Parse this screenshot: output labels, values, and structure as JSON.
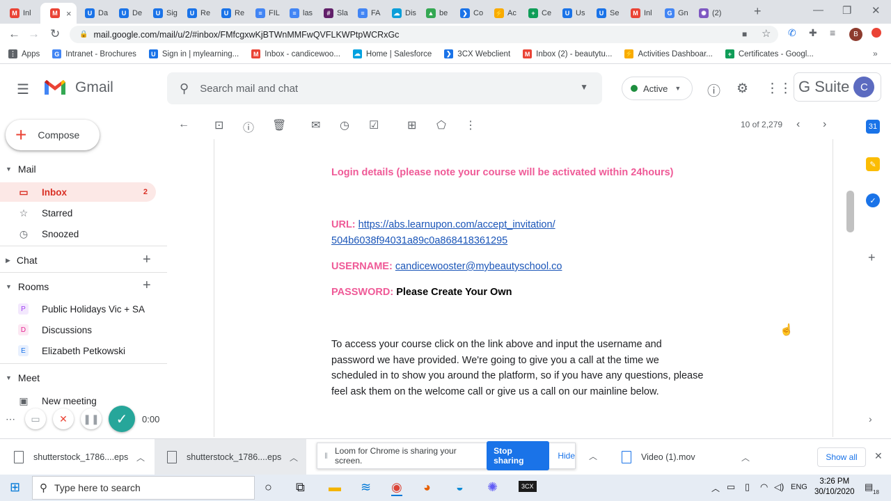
{
  "browser": {
    "tabs": [
      {
        "label": "Inl",
        "color": "#ea4335",
        "glyph": "M"
      },
      {
        "label": "",
        "color": "#ea4335",
        "glyph": "M",
        "active": true
      },
      {
        "label": "Da",
        "color": "#1a73e8",
        "glyph": "U"
      },
      {
        "label": "De",
        "color": "#1a73e8",
        "glyph": "U"
      },
      {
        "label": "Sig",
        "color": "#1a73e8",
        "glyph": "U"
      },
      {
        "label": "Re",
        "color": "#1a73e8",
        "glyph": "U"
      },
      {
        "label": "Re",
        "color": "#1a73e8",
        "glyph": "U"
      },
      {
        "label": "FIL",
        "color": "#4285f4",
        "glyph": "≡"
      },
      {
        "label": "las",
        "color": "#4285f4",
        "glyph": "≡"
      },
      {
        "label": "Sla",
        "color": "#611f69",
        "glyph": "#"
      },
      {
        "label": "FA",
        "color": "#4285f4",
        "glyph": "≡"
      },
      {
        "label": "Dis",
        "color": "#0b9ed9",
        "glyph": "☁"
      },
      {
        "label": "be",
        "color": "#34a853",
        "glyph": "▲"
      },
      {
        "label": "Co",
        "color": "#1a73e8",
        "glyph": "❯"
      },
      {
        "label": "Ac",
        "color": "#f9ab00",
        "glyph": "⚡"
      },
      {
        "label": "Ce",
        "color": "#0f9d58",
        "glyph": "+"
      },
      {
        "label": "Us",
        "color": "#1a73e8",
        "glyph": "U"
      },
      {
        "label": "Se",
        "color": "#1a73e8",
        "glyph": "U"
      },
      {
        "label": "Inl",
        "color": "#ea4335",
        "glyph": "M"
      },
      {
        "label": "Gn",
        "color": "#4285f4",
        "glyph": "G"
      },
      {
        "label": "(2)",
        "color": "#7e57c2",
        "glyph": "✺"
      }
    ],
    "url": "mail.google.com/mail/u/2/#inbox/FMfcgxwKjBTWnMMFwQVFLKWPtpWCRxGc",
    "profile": "B"
  },
  "bookmarks": [
    {
      "label": "Apps",
      "color": "#5f6368",
      "glyph": "⋮"
    },
    {
      "label": "Intranet - Brochures",
      "color": "#4285f4",
      "glyph": "G"
    },
    {
      "label": "Sign in | mylearning...",
      "color": "#1a73e8",
      "glyph": "U"
    },
    {
      "label": "Inbox - candicewoo...",
      "color": "#ea4335",
      "glyph": "M"
    },
    {
      "label": "Home | Salesforce",
      "color": "#00a1e0",
      "glyph": "☁"
    },
    {
      "label": "3CX Webclient",
      "color": "#1a73e8",
      "glyph": "❯"
    },
    {
      "label": "Inbox (2) - beautytu...",
      "color": "#ea4335",
      "glyph": "M"
    },
    {
      "label": "Activities Dashboar...",
      "color": "#f9ab00",
      "glyph": "⚡"
    },
    {
      "label": "Certificates - Googl...",
      "color": "#0f9d58",
      "glyph": "+"
    }
  ],
  "gmail": {
    "logo_text": "Gmail",
    "search_placeholder": "Search mail and chat",
    "status": "Active",
    "gsuite_label": "G Suite",
    "avatar": "C",
    "compose": "Compose",
    "mail_section": "Mail",
    "nav": [
      {
        "label": "Inbox",
        "count": "2",
        "icon": "inbox-icon",
        "glyph": "▭",
        "selected": true
      },
      {
        "label": "Starred",
        "count": "",
        "icon": "star-icon",
        "glyph": "☆"
      },
      {
        "label": "Snoozed",
        "count": "",
        "icon": "clock-icon",
        "glyph": "◷"
      }
    ],
    "chat_section": "Chat",
    "rooms_section": "Rooms",
    "rooms": [
      {
        "letter": "P",
        "label": "Public Holidays Vic + SA",
        "bg": "#f3e8fd",
        "fg": "#a142f4"
      },
      {
        "letter": "D",
        "label": "Discussions",
        "bg": "#fce8f3",
        "fg": "#e52592"
      },
      {
        "letter": "E",
        "label": "Elizabeth Petkowski",
        "bg": "#e8f0fe",
        "fg": "#1a73e8"
      }
    ],
    "meet_section": "Meet",
    "meet_items": [
      "New meeting"
    ],
    "pager": "10 of 2,279"
  },
  "recorder": {
    "time": "0:00"
  },
  "message": {
    "login_heading": "Login details (please note your course will be activated within 24hours)",
    "url_label": "URL:",
    "url_line1": "https://abs.learnupon.com/accept_invitation/",
    "url_line2": "504b6038f94031a89c0a868418361295",
    "username_label": "USERNAME:",
    "username_value": "candicewooster@mybeautyschool.co",
    "password_label": "PASSWORD:",
    "password_value": "Please Create Your Own",
    "body_lines": [
      "To access your course click on the link above and input the username and",
      "password we have provided. We're going to give you a call at the time we",
      "scheduled in to show you around the platform, so if you have any questions, please",
      "feel ask them on the welcome call or give us a call on our mainline below."
    ]
  },
  "downloads": {
    "items": [
      "shutterstock_1786....eps",
      "shutterstock_1786....eps",
      "Video (1).mov"
    ],
    "loom_text": "Loom for Chrome is sharing your screen.",
    "stop_label": "Stop sharing",
    "hide_label": "Hide",
    "show_all": "Show all"
  },
  "taskbar": {
    "search_placeholder": "Type here to search",
    "lang": "ENG",
    "time": "3:26 PM",
    "date": "30/10/2020",
    "notif_count": "18"
  }
}
